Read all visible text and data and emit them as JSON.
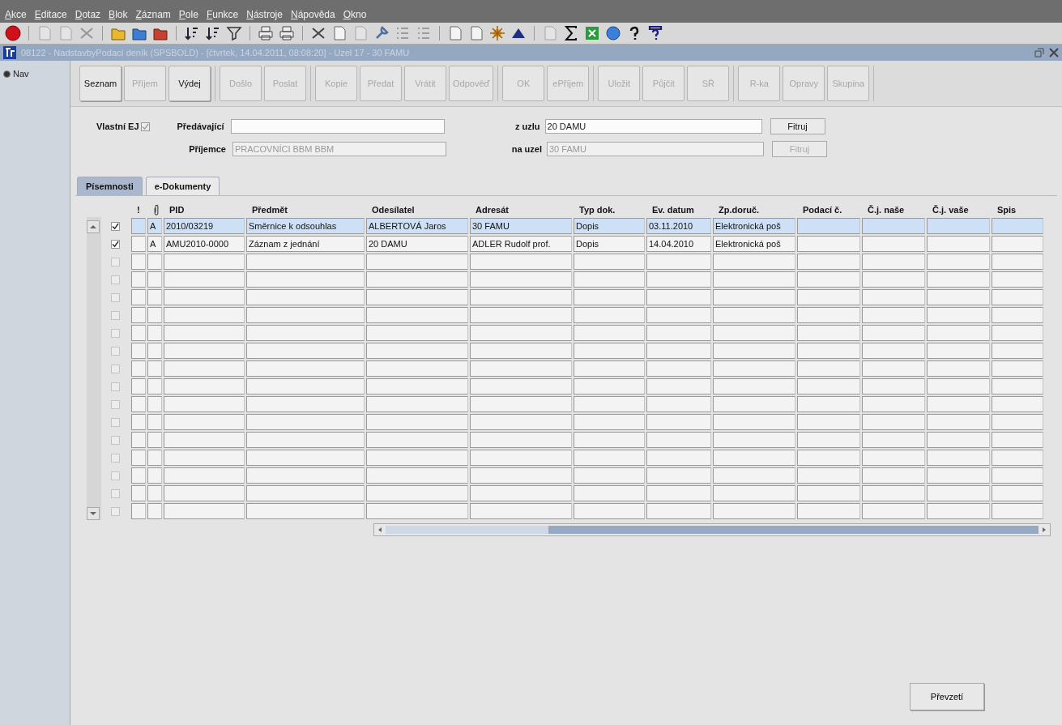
{
  "menu": [
    {
      "label": "Akce"
    },
    {
      "label": "Editace"
    },
    {
      "label": "Dotaz"
    },
    {
      "label": "Blok"
    },
    {
      "label": "Záznam"
    },
    {
      "label": "Pole"
    },
    {
      "label": "Funkce"
    },
    {
      "label": "Nástroje"
    },
    {
      "label": "Nápověda"
    },
    {
      "label": "Okno"
    }
  ],
  "window": {
    "title": "08122 - NadstavbyPodací deník (SPSBOLD) - [čtvrtek, 14.04.2011, 08:08:20] - Uzel 17 - 30 FAMU"
  },
  "nav": {
    "label": "Nav",
    "selected": true
  },
  "button_groups": [
    [
      {
        "label": "Seznam",
        "disabled": false
      },
      {
        "label": "Příjem",
        "disabled": true
      },
      {
        "label": "Výdej",
        "disabled": false
      }
    ],
    [
      {
        "label": "Došlo",
        "disabled": true
      },
      {
        "label": "Poslat",
        "disabled": true
      }
    ],
    [
      {
        "label": "Kopie",
        "disabled": true
      },
      {
        "label": "Předat",
        "disabled": true
      },
      {
        "label": "Vrátit",
        "disabled": true
      },
      {
        "label": "Odpověď",
        "disabled": true
      }
    ],
    [
      {
        "label": "OK",
        "disabled": true
      },
      {
        "label": "ePříjem",
        "disabled": true
      }
    ],
    [
      {
        "label": "Uložit",
        "disabled": true
      },
      {
        "label": "Půjčit",
        "disabled": true
      },
      {
        "label": "SŘ",
        "disabled": true
      }
    ],
    [
      {
        "label": "R-ka",
        "disabled": true
      },
      {
        "label": "Opravy",
        "disabled": true
      },
      {
        "label": "Skupina",
        "disabled": true
      }
    ]
  ],
  "form": {
    "own_unit": {
      "label": "Vlastní EJ",
      "checked": true
    },
    "sender": {
      "label": "Předávající"
    },
    "recipient": {
      "label": "Příjemce",
      "value": "PRACOVNÍCI BBM BBM",
      "disabled": true
    },
    "from_node": {
      "label": "z uzlu",
      "value": "20 DAMU",
      "button": "Fitruj",
      "disabled": false
    },
    "to_node": {
      "label": "na uzel",
      "value": "30 FAMU",
      "button": "Fitruj",
      "disabled": true
    }
  },
  "tabs": [
    {
      "label": "Písemnosti",
      "selected": false
    },
    {
      "label": "e-Dokumenty",
      "selected": true
    }
  ],
  "table": {
    "columns": [
      {
        "kind": "text",
        "label": "!"
      },
      {
        "kind": "icon"
      },
      {
        "kind": "text",
        "label": "PID"
      },
      {
        "kind": "text",
        "label": "Předmět"
      },
      {
        "kind": "text",
        "label": "Odesílatel"
      },
      {
        "kind": "text",
        "label": "Adresát"
      },
      {
        "kind": "text",
        "label": "Typ dok."
      },
      {
        "kind": "text",
        "label": "Ev. datum"
      },
      {
        "kind": "text",
        "label": "Zp.doruč."
      },
      {
        "kind": "text",
        "label": "Podací č."
      },
      {
        "kind": "text",
        "label": "Č.j. naše"
      },
      {
        "kind": "text",
        "label": "Č.j. vaše"
      },
      {
        "kind": "text",
        "label": "Spis"
      }
    ],
    "rows": [
      {
        "selected": true,
        "checked": true,
        "disabled": false,
        "attachment": "A",
        "pid": "2010/03219",
        "subject": "Směrnice k odsouhlas",
        "sender": "ALBERTOVÁ Jaros",
        "recipient": "30 FAMU",
        "doc_type": "Dopis",
        "date": "03.11.2010",
        "delivery": "Elektronická poš"
      },
      {
        "selected": false,
        "checked": true,
        "disabled": false,
        "attachment": "A",
        "pid": "AMU2010-0000",
        "subject": "Záznam z jednání",
        "sender": "20 DAMU",
        "recipient": "ADLER Rudolf prof.",
        "doc_type": "Dopis",
        "date": "14.04.2010",
        "delivery": "Elektronická poš"
      },
      {
        "selected": false,
        "checked": false,
        "disabled": true
      },
      {
        "selected": false,
        "checked": false,
        "disabled": true
      },
      {
        "selected": false,
        "checked": false,
        "disabled": true
      },
      {
        "selected": false,
        "checked": false,
        "disabled": true
      },
      {
        "selected": false,
        "checked": false,
        "disabled": true
      },
      {
        "selected": false,
        "checked": false,
        "disabled": true
      },
      {
        "selected": false,
        "checked": false,
        "disabled": true
      },
      {
        "selected": false,
        "checked": false,
        "disabled": true
      },
      {
        "selected": false,
        "checked": false,
        "disabled": true
      },
      {
        "selected": false,
        "checked": false,
        "disabled": true
      },
      {
        "selected": false,
        "checked": false,
        "disabled": true
      },
      {
        "selected": false,
        "checked": false,
        "disabled": true
      },
      {
        "selected": false,
        "checked": false,
        "disabled": true
      },
      {
        "selected": false,
        "checked": false,
        "disabled": true
      },
      {
        "selected": false,
        "checked": false,
        "disabled": true
      }
    ]
  },
  "accept_button": "Převzetí"
}
